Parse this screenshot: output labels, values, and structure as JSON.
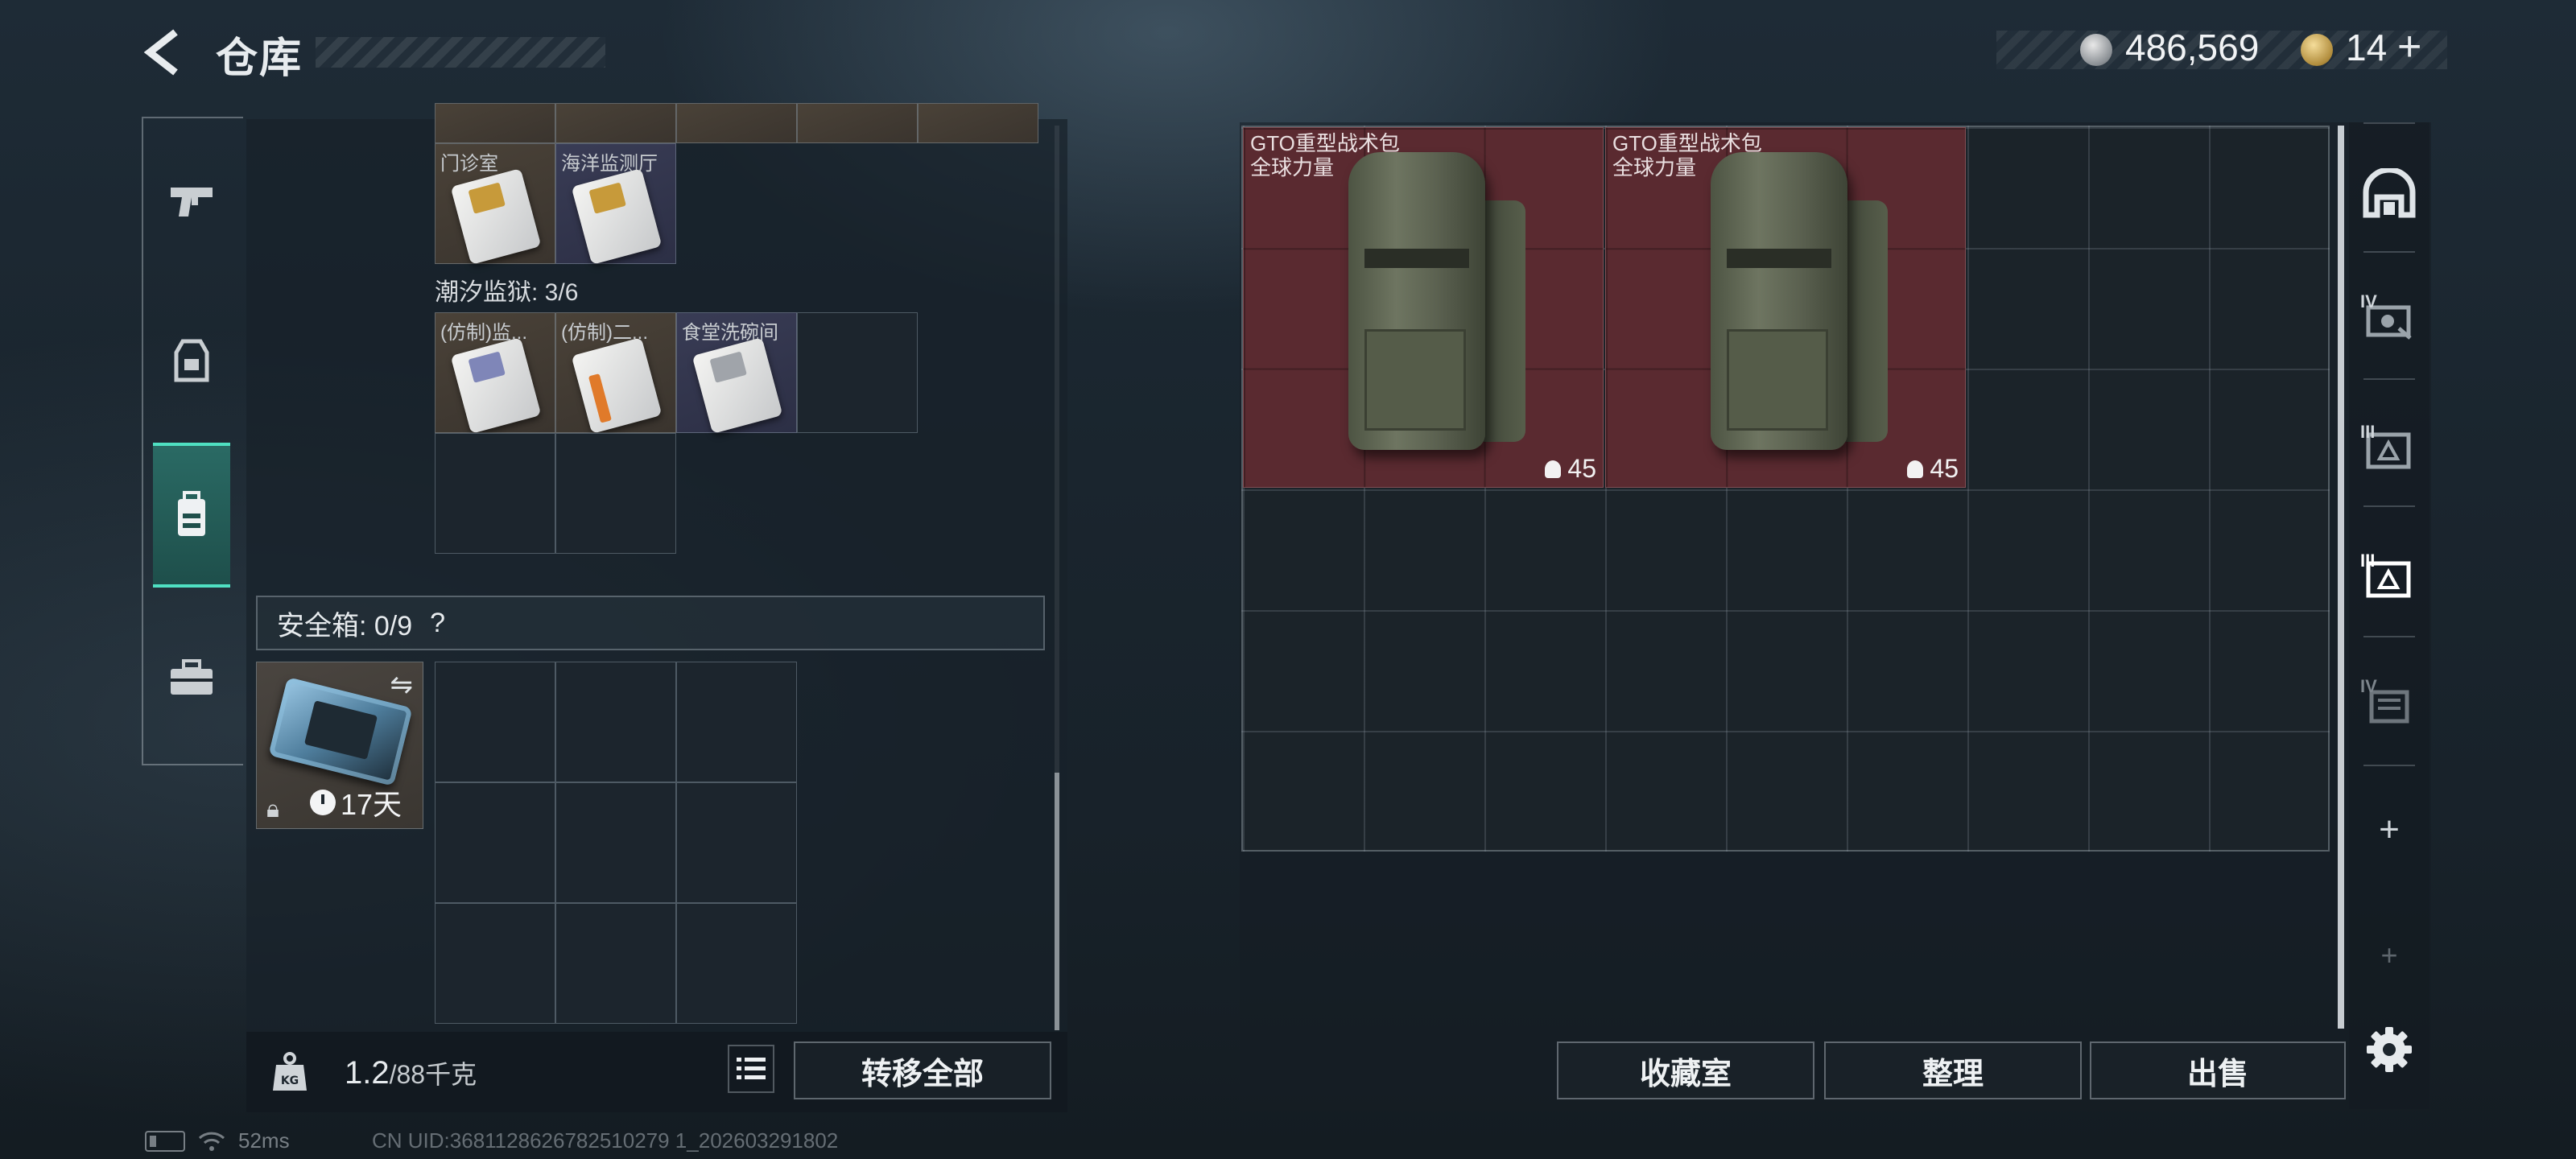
{
  "header": {
    "title": "仓库",
    "back_icon": "chevron-left-icon",
    "silver_amount": "486,569",
    "gold_amount": "14",
    "add_label": "+"
  },
  "nav": {
    "items": [
      {
        "name": "weapon",
        "icon": "pistol-icon",
        "active": false
      },
      {
        "name": "equipment",
        "icon": "vest-icon",
        "active": false
      },
      {
        "name": "backpack",
        "icon": "backpack-icon",
        "active": true
      },
      {
        "name": "toolbox",
        "icon": "briefcase-icon",
        "active": false
      }
    ]
  },
  "left": {
    "top_cards": [
      {
        "label": "门诊室",
        "style": "tan",
        "stripe": "gold"
      },
      {
        "label": "海洋监测厅",
        "style": "blue",
        "stripe": "gold"
      }
    ],
    "section_label": "潮汐监狱: 3/6",
    "section_cards": [
      {
        "label": "(仿制)监...",
        "style": "tan",
        "stripe": "purple"
      },
      {
        "label": "(仿制)二...",
        "style": "tan",
        "stripe": "orange"
      },
      {
        "label": "食堂洗碗间",
        "style": "blue",
        "stripe": "grey"
      }
    ],
    "safebox": {
      "label": "安全箱: 0/9",
      "help": "?",
      "timer": "17天",
      "swap_icon": "swap-icon",
      "lock_icon": "lock-icon"
    },
    "weight": {
      "current": "1.2",
      "max": "/88千克",
      "icon": "weight-kg-icon",
      "unit_icon_text": "KG"
    },
    "transfer_all": "转移全部"
  },
  "right": {
    "bags": [
      {
        "name": "GTO重型战术包",
        "sub": "全球力量",
        "count": "45"
      },
      {
        "name": "GTO重型战术包",
        "sub": "全球力量",
        "count": "45"
      }
    ],
    "tabs": [
      {
        "icon": "helmet-tab-icon",
        "tier": ""
      },
      {
        "icon": "case-tier-icon",
        "tier": "IV"
      },
      {
        "icon": "case-tier-icon",
        "tier": "III"
      },
      {
        "icon": "case-tier-icon",
        "tier": "III"
      },
      {
        "icon": "case-tier-icon",
        "tier": "IV"
      }
    ],
    "buttons": {
      "store": "收藏室",
      "sort": "整理",
      "sell": "出售"
    }
  },
  "status": {
    "ping": "52ms",
    "uid": "CN UID:3681128626782510279 1_202603291802"
  }
}
